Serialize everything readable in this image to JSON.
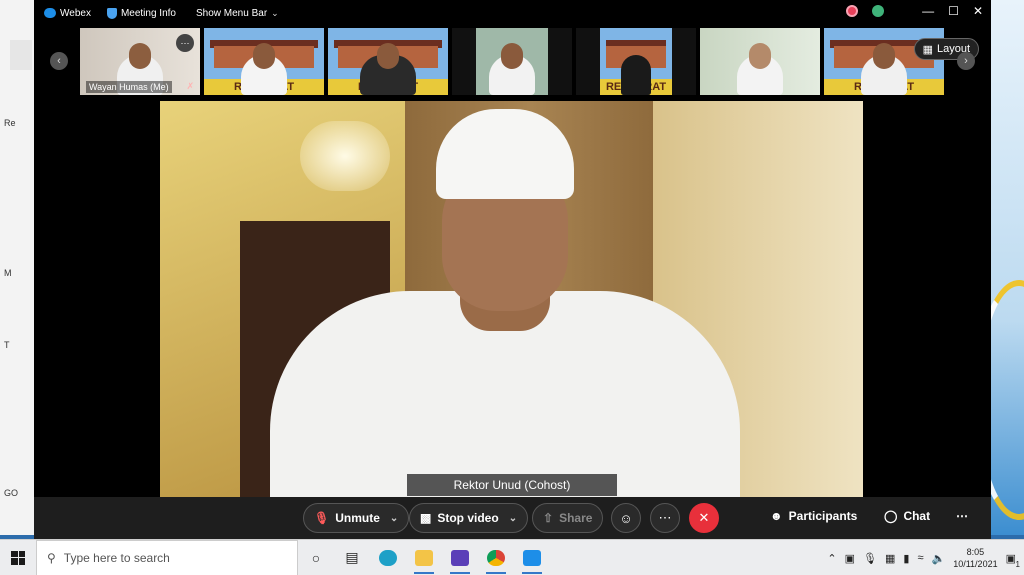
{
  "desktop": {
    "left_labels": [
      "Re",
      "M",
      "T",
      "GO"
    ]
  },
  "titlebar": {
    "app_name": "Webex",
    "meeting_info": "Meeting Info",
    "show_menu_bar": "Show Menu Bar"
  },
  "filmstrip": {
    "layout_label": "Layout",
    "tiles": [
      {
        "name": "Wayan Humas (Me)",
        "muted": true,
        "self": true
      },
      {
        "name": "",
        "muted": false
      },
      {
        "name": "",
        "muted": false
      },
      {
        "name": "",
        "muted": false
      },
      {
        "name": "",
        "muted": false
      },
      {
        "name": "",
        "muted": false
      },
      {
        "name": "",
        "muted": false
      }
    ],
    "banner_text": "REKTORAT"
  },
  "main_video": {
    "speaker_label": "Rektor Unud (Cohost)"
  },
  "controls": {
    "unmute_label": "Unmute",
    "stop_video_label": "Stop video",
    "share_label": "Share",
    "participants_label": "Participants",
    "chat_label": "Chat"
  },
  "taskbar": {
    "search_placeholder": "Type here to search",
    "time": "8:05",
    "date": "10/11/2021",
    "notifications": "1"
  },
  "colors": {
    "end_call": "#e8303b",
    "accent": "#1d8ee8",
    "banner": "#e8c93a"
  }
}
